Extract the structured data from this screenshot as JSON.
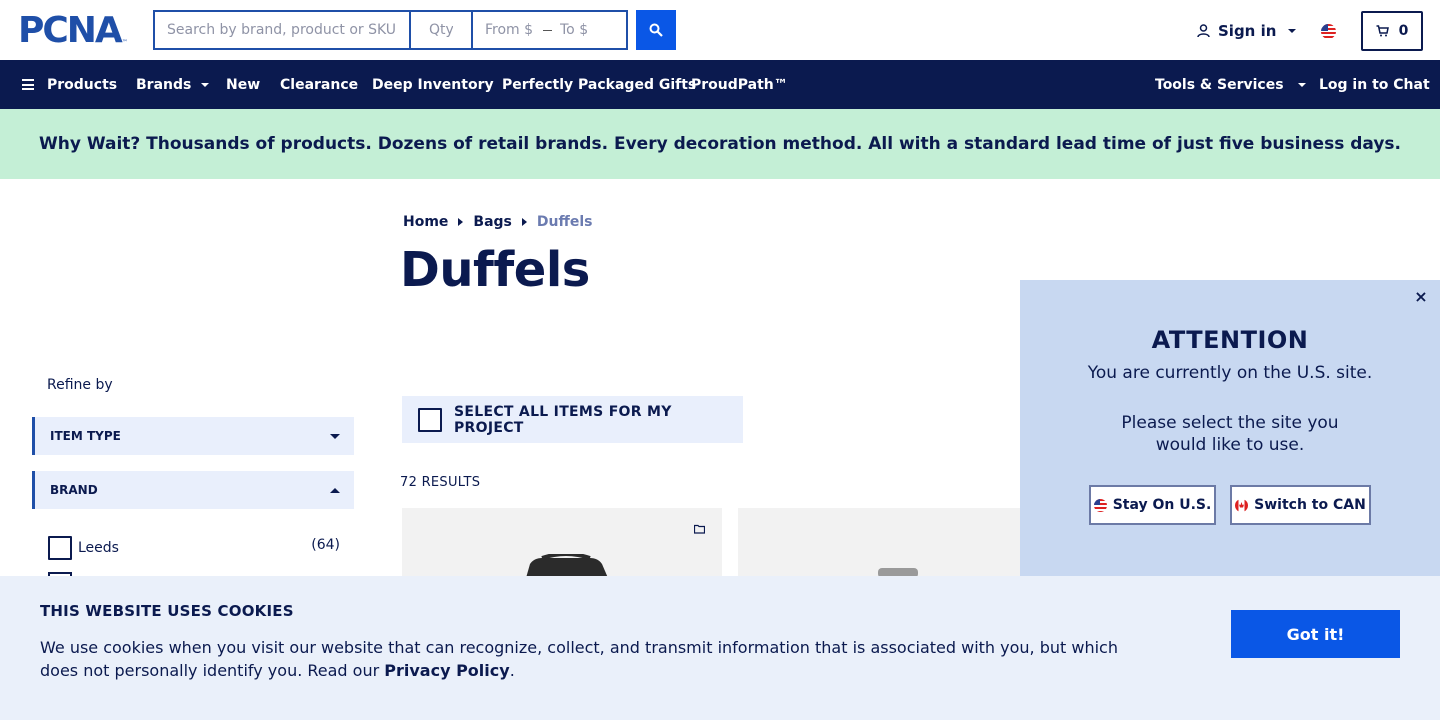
{
  "header": {
    "logo_text": "PCNA",
    "logo_tm": "™",
    "search_placeholder": "Search by brand, product or SKU",
    "qty_placeholder": "Qty",
    "price_from_placeholder": "From $",
    "price_to_placeholder": "To $",
    "sign_in_label": "Sign in",
    "cart_count": "0",
    "accent_color": "#0a57e6"
  },
  "nav": {
    "items": [
      {
        "label": "Products",
        "icon": "hamburger-icon"
      },
      {
        "label": "Brands",
        "dropdown": true
      },
      {
        "label": "New"
      },
      {
        "label": "Clearance"
      },
      {
        "label": "Deep Inventory"
      },
      {
        "label": "Perfectly Packaged Gifts"
      },
      {
        "label": "ProudPath™"
      },
      {
        "label": "Tools & Services",
        "dropdown": true
      },
      {
        "label": "Log in to Chat"
      }
    ],
    "background": "#0b1a4f"
  },
  "promo": {
    "text": "Why Wait? Thousands of products. Dozens of retail brands. Every decoration method. All with a standard lead time of just five business days.",
    "background": "#c4efd6"
  },
  "breadcrumb": {
    "items": [
      "Home",
      "Bags",
      "Duffels"
    ]
  },
  "page_title": "Duffels",
  "sidebar": {
    "refine_label": "Refine by",
    "facets": [
      {
        "label": "ITEM TYPE",
        "expanded": false
      },
      {
        "label": "BRAND",
        "expanded": true
      }
    ],
    "brand_options": [
      {
        "label": "Leeds",
        "count": "(64)",
        "checked": false
      }
    ]
  },
  "listing": {
    "select_all_label": "SELECT ALL ITEMS FOR MY PROJECT",
    "results_label": "72 RESULTS"
  },
  "region_modal": {
    "title": "ATTENTION",
    "subtitle": "You are currently on the U.S. site.",
    "message": "Please select the site you would like to use.",
    "stay_label": "Stay On U.S.",
    "switch_label": "Switch to CAN",
    "close_symbol": "×"
  },
  "cookie_banner": {
    "title": "THIS WEBSITE USES COOKIES",
    "body": "We use cookies when you visit our website that can recognize, collect, and transmit information that is associated with you, but which does not personally identify you. Read our ",
    "link_label": "Privacy Policy",
    "body_end": ".",
    "button_label": "Got it!"
  }
}
